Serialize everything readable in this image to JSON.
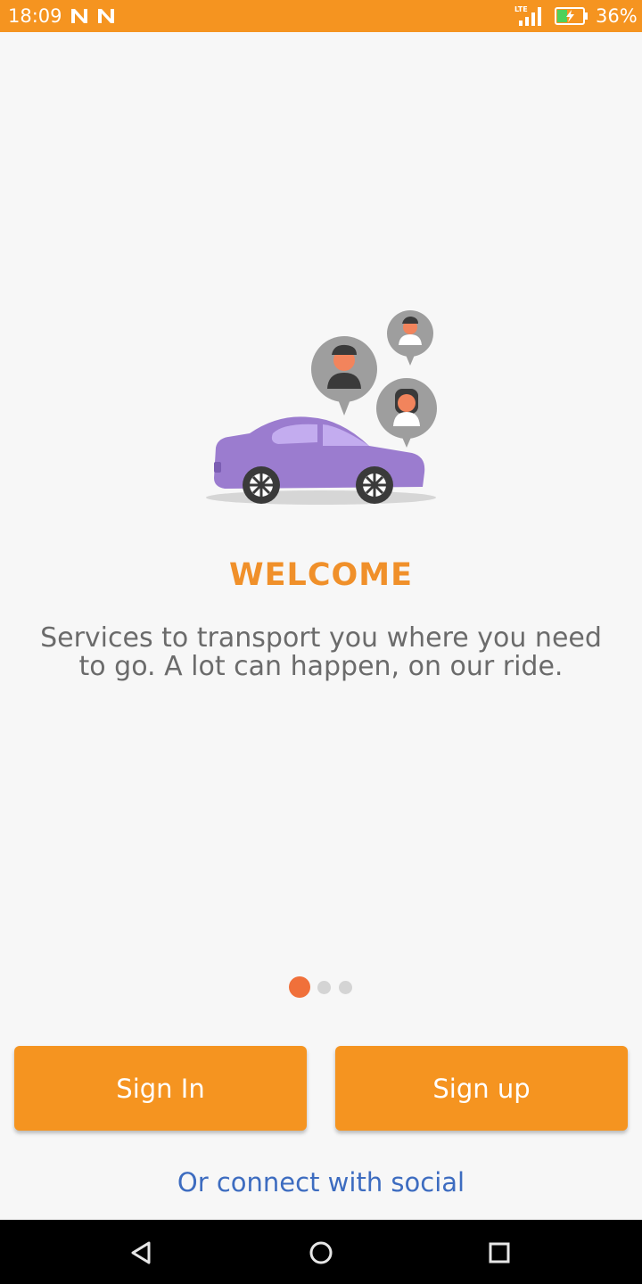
{
  "status_bar": {
    "time": "18:09",
    "battery_percent": "36%",
    "network": "LTE",
    "notification_icons": [
      "n-notification-icon",
      "n-notification-icon"
    ],
    "color": "#f59420"
  },
  "onboarding": {
    "illustration": "car-with-passengers-illustration",
    "title": "WELCOME",
    "subtitle": "Services to transport you where you need to go. A lot can happen, on our ride.",
    "page_indicator": {
      "current": 1,
      "total": 3
    }
  },
  "actions": {
    "sign_in_label": "Sign In",
    "sign_up_label": "Sign up",
    "social_label": "Or connect with social"
  },
  "nav_bar": {
    "buttons": [
      "back-icon",
      "home-icon",
      "recents-icon"
    ]
  },
  "colors": {
    "accent": "#f59420",
    "title": "#f0902a",
    "link": "#3d6cc0",
    "car": "#9b7ccf",
    "indicator_active": "#f0703a"
  }
}
